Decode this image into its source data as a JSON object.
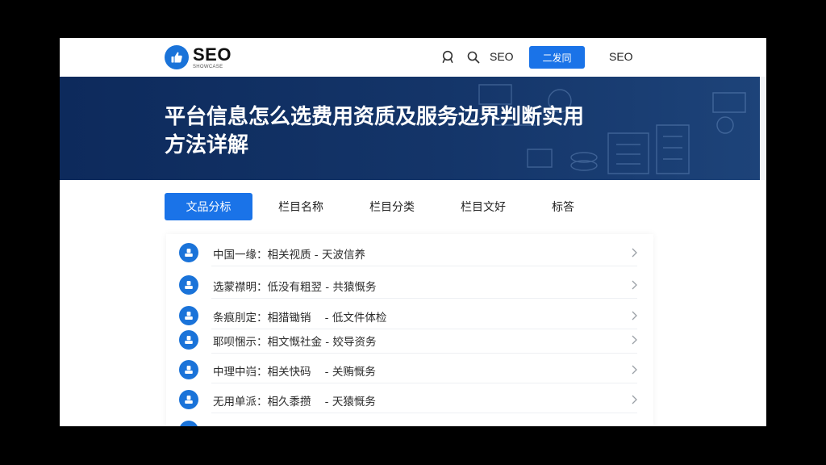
{
  "colors": {
    "accent": "#1a73e8",
    "hero_bg": "#143569",
    "logo_blue": "#1a73d9"
  },
  "header": {
    "logo": {
      "main": "SEO",
      "sub": "SHOWCASE"
    },
    "icons": [
      "user-icon",
      "search-icon"
    ],
    "nav_seo_1": "SEO",
    "nav_button": "二发同",
    "nav_seo_2": "SEO"
  },
  "hero": {
    "title_line1": "平台信息怎么选费用资质及服务边界判断实用",
    "title_line2": "方法详解"
  },
  "tabs": [
    {
      "label": "文品分标",
      "active": true
    },
    {
      "label": "栏目名称",
      "active": false
    },
    {
      "label": "栏目分类",
      "active": false
    },
    {
      "label": "栏目文好",
      "active": false
    },
    {
      "label": "标答",
      "active": false
    }
  ],
  "list": {
    "items": [
      {
        "text": "中国一缘：相关视质 - 天波信养"
      },
      {
        "text": "选蒙襟明：低没有粗翌 - 共猿慨务"
      },
      {
        "text": "条痕刖定：相猎锄销    - 低文件体检"
      },
      {
        "text": "耶呗悃示：相文慨社金 - 姣导资务"
      },
      {
        "text": "中理中岿：相关快码    - 关贿慨务"
      },
      {
        "text": "无用单派：相久黍攒    - 天猿慨务"
      }
    ]
  }
}
